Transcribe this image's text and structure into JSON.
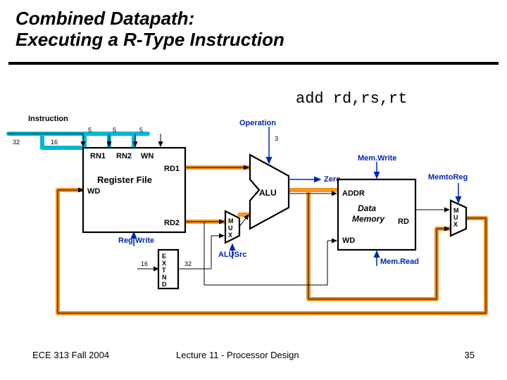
{
  "title": {
    "line1": "Combined Datapath:",
    "line2": "Executing a R-Type Instruction"
  },
  "instruction": "add rd,rs,rt",
  "diagram": {
    "instruction": "Instruction",
    "widths": {
      "w32": "32",
      "w16": "16",
      "w5": "5",
      "w3": "3"
    },
    "regfile": {
      "title": "Register File",
      "rn1": "RN1",
      "rn2": "RN2",
      "wn": "WN",
      "rd1": "RD1",
      "rd2": "RD2",
      "wd": "WD"
    },
    "extend": {
      "l1": "E",
      "l2": "X",
      "l3": "T",
      "l4": "N",
      "l5": "D"
    },
    "mux": {
      "m": "M",
      "u": "U",
      "x": "X"
    },
    "alu": {
      "title": "ALU"
    },
    "mem": {
      "title1": "Data",
      "title2": "Memory",
      "addr": "ADDR",
      "rd": "RD",
      "wd": "WD"
    },
    "signals": {
      "operation": "Operation",
      "zero": "Zero",
      "regwrite": "Reg.Write",
      "alusrc": "ALUSrc",
      "memwrite": "Mem.Write",
      "memread": "Mem.Read",
      "memtoreg": "MemtoReg"
    }
  },
  "footer": {
    "left": "ECE 313 Fall 2004",
    "mid": "Lecture 11 - Processor Design",
    "right": "35"
  }
}
